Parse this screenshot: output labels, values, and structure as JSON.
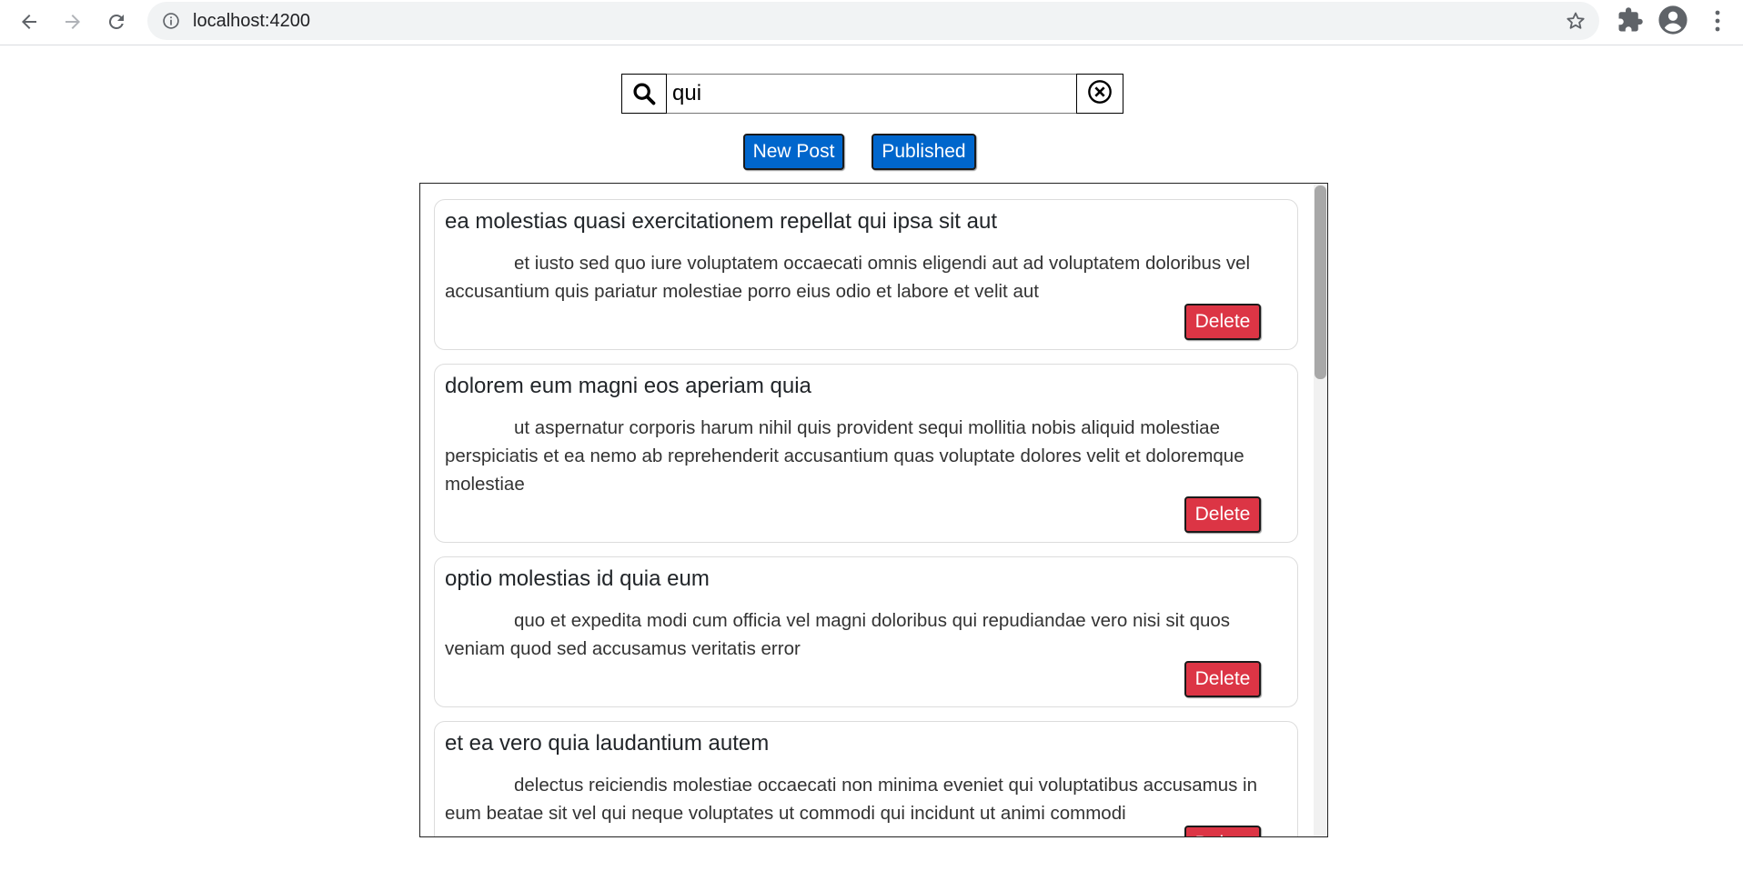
{
  "browser": {
    "url": "localhost:4200",
    "icons": [
      "back-arrow-icon",
      "forward-arrow-icon",
      "reload-icon",
      "info-icon",
      "star-icon",
      "puzzle-icon",
      "account-icon",
      "kebab-menu-icon"
    ]
  },
  "search": {
    "value": "qui",
    "icon": "search-icon",
    "clear_icon": "clear-circle-x-icon"
  },
  "toolbar": {
    "new_post_label": "New Post",
    "published_label": "Published"
  },
  "colors": {
    "primary": "#0066cc",
    "danger": "#dc3545"
  },
  "posts": [
    {
      "title": "ea molestias quasi exercitationem repellat qui ipsa sit aut",
      "body": "et iusto sed quo iure voluptatem occaecati omnis eligendi aut ad voluptatem doloribus vel accusantium quis pariatur molestiae porro eius odio et labore et velit aut",
      "delete_label": "Delete"
    },
    {
      "title": "dolorem eum magni eos aperiam quia",
      "body": "ut aspernatur corporis harum nihil quis provident sequi mollitia nobis aliquid molestiae perspiciatis et ea nemo ab reprehenderit accusantium quas voluptate dolores velit et doloremque molestiae",
      "delete_label": "Delete"
    },
    {
      "title": "optio molestias id quia eum",
      "body": "quo et expedita modi cum officia vel magni doloribus qui repudiandae vero nisi sit quos veniam quod sed accusamus veritatis error",
      "delete_label": "Delete"
    },
    {
      "title": "et ea vero quia laudantium autem",
      "body": "delectus reiciendis molestiae occaecati non minima eveniet qui voluptatibus accusamus in eum beatae sit vel qui neque voluptates ut commodi qui incidunt ut animi commodi",
      "delete_label": "Delete"
    }
  ]
}
